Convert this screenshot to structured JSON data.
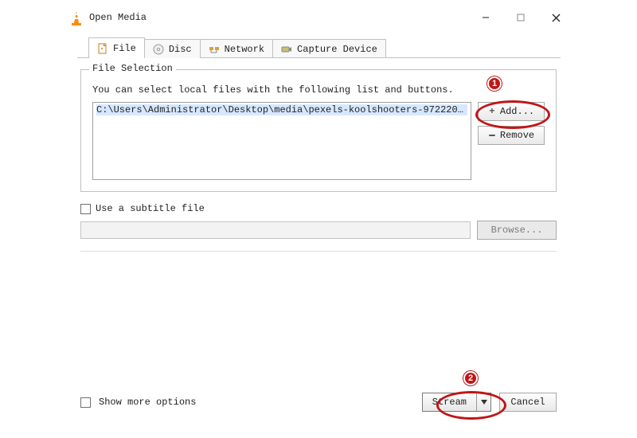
{
  "window": {
    "title": "Open Media"
  },
  "tabs": {
    "file": {
      "label": "File"
    },
    "disc": {
      "label": "Disc"
    },
    "network": {
      "label": "Network"
    },
    "capture": {
      "label": "Capture Device"
    }
  },
  "file_selection": {
    "group_title": "File Selection",
    "hint": "You can select local files with the following list and buttons.",
    "files": [
      "C:\\Users\\Administrator\\Desktop\\media\\pexels-koolshooters-972220..."
    ],
    "add_label": "Add...",
    "remove_label": "Remove"
  },
  "subtitle": {
    "checkbox_label": "Use a subtitle file",
    "browse_label": "Browse..."
  },
  "bottom": {
    "show_more_label": "Show more options",
    "stream_label": "Stream",
    "cancel_label": "Cancel"
  },
  "annotations": {
    "badge1": "1",
    "badge2": "2"
  }
}
